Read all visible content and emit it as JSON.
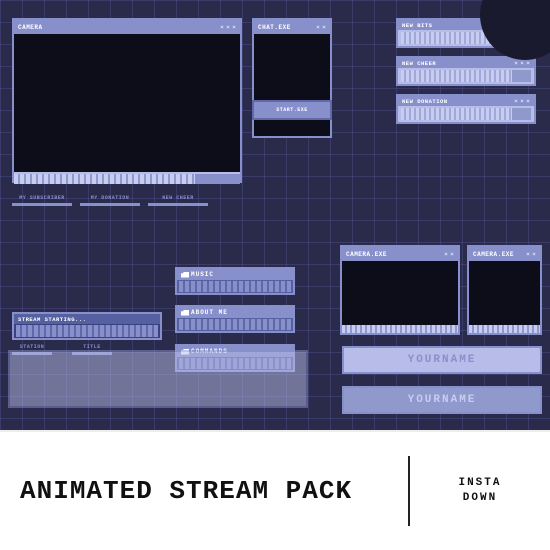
{
  "topSection": {
    "mainWebcam": {
      "titlebar": "CAMERA",
      "dots": [
        "■",
        "■",
        "■"
      ]
    },
    "chatWindow": {
      "titlebar": "CHAT.EXE"
    },
    "startExe": {
      "text": "START.EXE"
    },
    "bottomPanels": [
      {
        "label": "MY SUBSCRIBER"
      },
      {
        "label": "MY DONATION"
      },
      {
        "label": "NEW CHEER"
      }
    ],
    "notifications": [
      {
        "label": "NEW BITS"
      },
      {
        "label": "NEW CHEER"
      },
      {
        "label": "NEW DONATION"
      }
    ],
    "streamStarting": {
      "text": "STREAM STARTING..."
    },
    "streamStartLabels": [
      {
        "label": "STATION"
      },
      {
        "label": "TITLE"
      }
    ],
    "panels": [
      {
        "id": "music",
        "title": "MUSIC"
      },
      {
        "id": "about",
        "title": "ABOUT ME"
      },
      {
        "id": "commands",
        "title": "COMMANDS"
      }
    ],
    "yournameTop": "YOURNAME",
    "yournameBottom": "YOURNAME",
    "medWebcam1": {
      "titlebar": "CAMERA.EXE"
    },
    "medWebcam2": {
      "titlebar": "CAMERA.EXE"
    }
  },
  "bottomSection": {
    "animatedLabel": "NIMATED STREAM PACK",
    "prefix": "A",
    "rightLabel1": "INSTA",
    "rightLabel2": "DOWN"
  }
}
